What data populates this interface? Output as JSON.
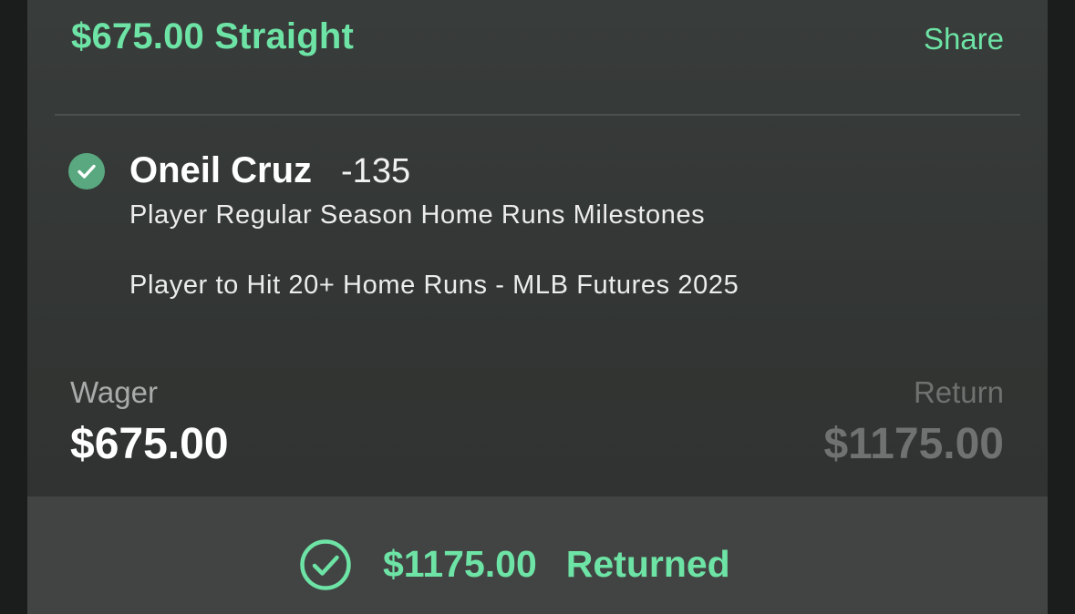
{
  "header": {
    "title": "$675.00 Straight",
    "share_label": "Share"
  },
  "selection": {
    "status_icon": "check-circle-filled-icon",
    "player": "Oneil Cruz",
    "odds": "-135",
    "market": "Player Regular Season Home Runs Milestones",
    "event": "Player to Hit 20+ Home Runs - MLB Futures 2025"
  },
  "summary": {
    "wager_label": "Wager",
    "wager_value": "$675.00",
    "return_label": "Return",
    "return_value": "$1175.00"
  },
  "footer": {
    "icon": "check-circle-outline-icon",
    "amount": "$1175.00",
    "status": "Returned"
  },
  "colors": {
    "accent_green": "#6de3a5",
    "check_badge_green": "#59a87f",
    "card_background": "#383c3a",
    "footer_background": "#424443"
  }
}
